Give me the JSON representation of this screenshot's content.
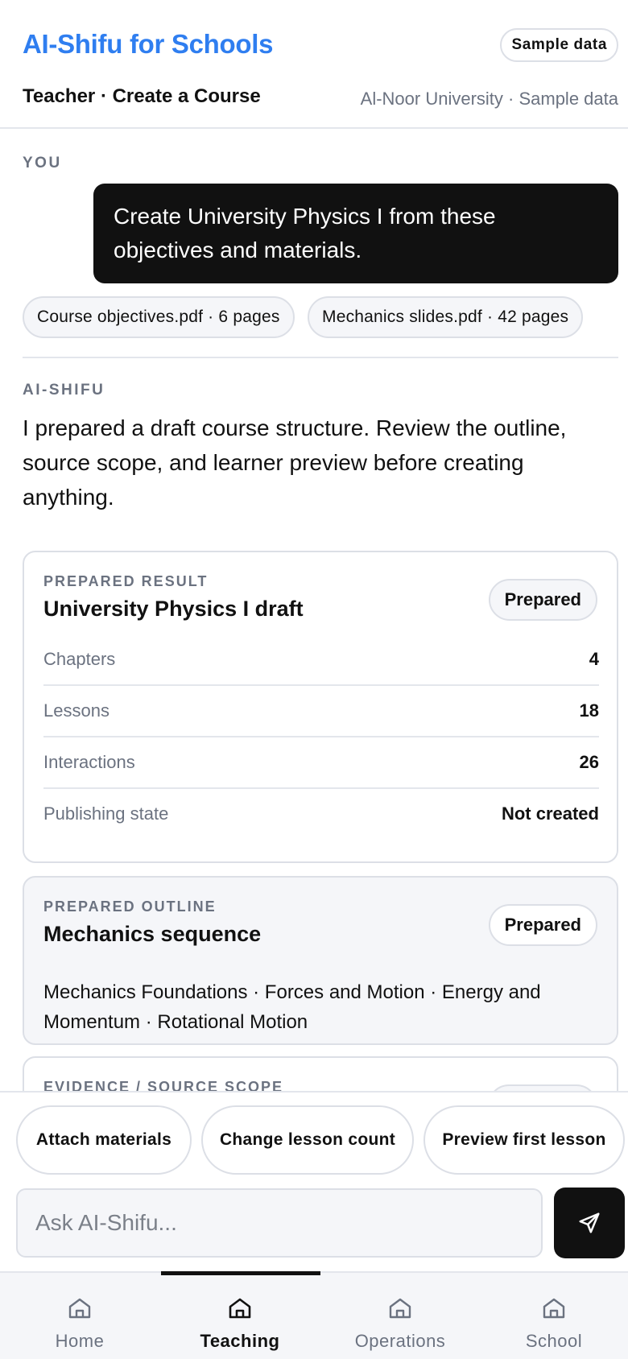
{
  "header": {
    "brand": "AI-Shifu for Schools",
    "sample_pill": "Sample data",
    "subtitle": "Teacher · Create a Course",
    "org": "Al-Noor University · Sample data"
  },
  "conversation": {
    "you_label": "YOU",
    "user_message": "Create University Physics I from these objectives and materials.",
    "attachments": [
      {
        "label": "Course objectives.pdf · 6 pages"
      },
      {
        "label": "Mechanics slides.pdf · 42 pages"
      }
    ],
    "ai_label": "AI-SHIFU",
    "ai_message": "I prepared a draft course structure. Review the outline, source scope, and learner preview before creating anything."
  },
  "result_card": {
    "label": "PREPARED RESULT",
    "title": "University Physics I draft",
    "status": "Prepared",
    "rows": [
      {
        "key": "Chapters",
        "value": "4"
      },
      {
        "key": "Lessons",
        "value": "18"
      },
      {
        "key": "Interactions",
        "value": "26"
      },
      {
        "key": "Publishing state",
        "value": "Not created"
      }
    ]
  },
  "outline_card": {
    "label": "PREPARED OUTLINE",
    "title": "Mechanics sequence",
    "status": "Prepared",
    "text": "Mechanics Foundations · Forces and Motion · Energy and Momentum · Rotational Motion"
  },
  "evidence_card": {
    "label": "EVIDENCE / SOURCE SCOPE"
  },
  "actions": {
    "attach": "Attach materials",
    "change_count": "Change lesson count",
    "preview": "Preview first lesson"
  },
  "input": {
    "placeholder": "Ask AI-Shifu..."
  },
  "nav": {
    "items": [
      {
        "label": "Home",
        "icon": "home-icon"
      },
      {
        "label": "Teaching",
        "icon": "home-icon",
        "active": true
      },
      {
        "label": "Operations",
        "icon": "home-icon"
      },
      {
        "label": "School",
        "icon": "home-icon"
      }
    ]
  },
  "colors": {
    "brand": "#2f7ef0",
    "bubble": "#111111",
    "muted": "#6b7280",
    "border": "#dcdfe6"
  }
}
